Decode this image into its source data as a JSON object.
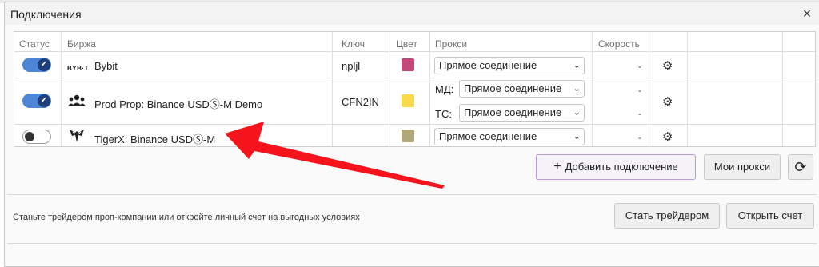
{
  "window": {
    "title": "Подключения",
    "close_label": "×"
  },
  "table": {
    "headers": {
      "status": "Статус",
      "exchange": "Биржа",
      "key": "Ключ",
      "color": "Цвет",
      "proxy": "Прокси",
      "speed": "Скорость"
    },
    "rows": [
      {
        "enabled": true,
        "logo_text": "BYB·T",
        "exchange": "Bybit",
        "key": "npljl",
        "color": "#c2477a",
        "proxy": "Прямое соединение",
        "speed": "-"
      },
      {
        "enabled": true,
        "exchange": "Prod Prop: Binance USDⓈ-M Demo",
        "key": "CFN2IN",
        "color": "#f7d94c",
        "proxy_md_label": "МД:",
        "proxy_md": "Прямое соединение",
        "proxy_tc_label": "ТС:",
        "proxy_tc": "Прямое соединение",
        "speed_md": "-",
        "speed_tc": "-"
      },
      {
        "enabled": false,
        "exchange": "TigerX: Binance USDⓈ-M",
        "key": "",
        "color": "#b0a878",
        "proxy": "Прямое соединение",
        "speed": "-"
      }
    ]
  },
  "actions": {
    "add_connection": "Добавить подключение",
    "my_proxies": "Мои прокси"
  },
  "promo": {
    "text": "Станьте трейдером проп-компании или откройте личный счет на выгодных условиях",
    "become_trader": "Стать трейдером",
    "open_account": "Открыть счет"
  },
  "annotation": {
    "arrow_color": "#f5141c"
  },
  "icons": {
    "check": "checkmark-icon",
    "people": "people-icon",
    "tiger": "tiger-logo-icon",
    "gear": "gear-icon",
    "refresh": "refresh-icon",
    "chevron": "chevron-down-icon"
  }
}
